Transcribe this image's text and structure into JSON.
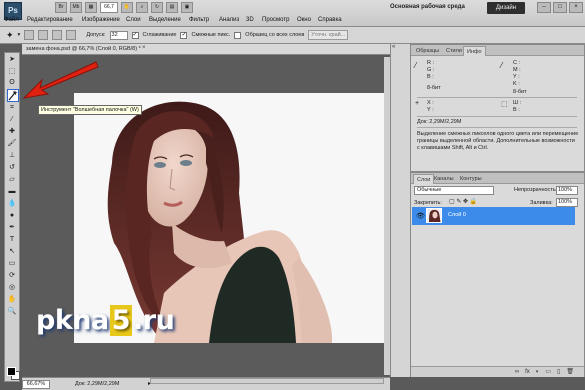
{
  "app": {
    "logo": "Ps",
    "workspace_label": "Основная рабочая среда",
    "workspace_button": "Дизайн"
  },
  "menu": [
    "Файл",
    "Редактирование",
    "Изображение",
    "Слои",
    "Выделение",
    "Фильтр",
    "Анализ",
    "3D",
    "Просмотр",
    "Окно",
    "Справка"
  ],
  "menu_icons": {
    "zoom_value": "66,7"
  },
  "window_controls": [
    "–",
    "□",
    "×"
  ],
  "options": {
    "tolerance_label": "Допуск:",
    "tolerance_value": "32",
    "antialias_label": "Сглаживание",
    "antialias_checked": true,
    "contiguous_label": "Смежные пикс.",
    "contiguous_checked": true,
    "all_layers_label": "Образец со всех слоев",
    "all_layers_checked": false,
    "refine_label": "Уточн. край..."
  },
  "document": {
    "tab_title": "замена фона.psd @ 66,7% (Слой 0, RGB/8) *",
    "close": "×"
  },
  "tooltip": "Инструмент \"Волшебная палочка\" (W)",
  "status": {
    "zoom": "66,67%",
    "doc_size": "Док: 2,29M/2,29M",
    "arrow": "▸"
  },
  "panel_info": {
    "tabs": [
      "Образцы",
      "Стили",
      "Инфо"
    ],
    "active_tab": 2,
    "rgb_labels": [
      "R :",
      "G :",
      "B :"
    ],
    "cmyk_labels": [
      "C :",
      "M :",
      "Y :",
      "K :"
    ],
    "bit_left": "8-бит",
    "bit_right": "8-бит",
    "xy_labels": [
      "X :",
      "Y :"
    ],
    "wh_labels": [
      "Ш :",
      "В :"
    ],
    "doc_size": "Док: 2,29M/2,29M",
    "help_text": [
      "Выделение смежных пикселов одного цвета или перемещение",
      "границы выделенной области. Дополнительные возможности",
      "с клавишами Shift, Alt и Ctrl."
    ]
  },
  "panel_layers": {
    "tabs": [
      "Слои",
      "Каналы",
      "Контуры"
    ],
    "active_tab": 0,
    "blend_mode": "Обычные",
    "opacity_label": "Непрозрачность:",
    "opacity_value": "100%",
    "lock_label": "Закрепить:",
    "fill_label": "Заливка:",
    "fill_value": "100%",
    "layer_name": "Слой 0",
    "footer_icons": [
      "fx",
      "◐",
      "▭",
      "▯",
      "🗑"
    ]
  },
  "watermark": {
    "part1": "pkna",
    "digit": "5",
    "part2": ".ru"
  },
  "colors": {
    "accent_red": "#e02010",
    "layer_selected": "#3c8bea",
    "watermark_yellow": "#e7c71a"
  }
}
